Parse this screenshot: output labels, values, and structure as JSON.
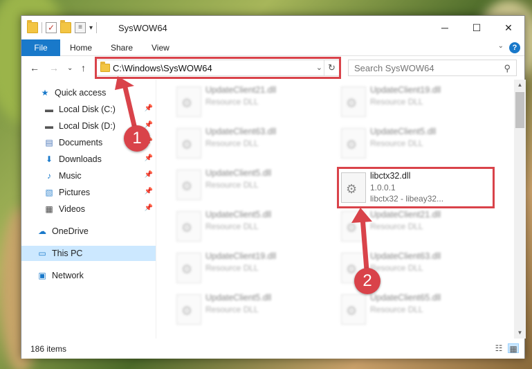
{
  "window": {
    "title": "SysWOW64",
    "controls": {
      "minimize": "─",
      "maximize": "☐",
      "close": "✕"
    }
  },
  "ribbon": {
    "file": "File",
    "tabs": [
      "Home",
      "Share",
      "View"
    ],
    "help": "?",
    "collapse": "⌄"
  },
  "nav": {
    "back": "←",
    "forward": "→",
    "recent": "⌄",
    "up": "↑",
    "address": "C:\\Windows\\SysWOW64",
    "address_dropdown": "⌄",
    "refresh": "↻",
    "search_placeholder": "Search SysWOW64",
    "search_icon_glyph": "⚲"
  },
  "sidebar": {
    "items": [
      {
        "label": "Quick access",
        "icon": "star-icon",
        "glyph": "★",
        "color": "#1979ca",
        "pinned": false
      },
      {
        "label": "Local Disk (C:)",
        "icon": "drive-icon",
        "glyph": "▬",
        "color": "#555555",
        "pinned": true
      },
      {
        "label": "Local Disk (D:)",
        "icon": "drive-icon",
        "glyph": "▬",
        "color": "#555555",
        "pinned": true
      },
      {
        "label": "Documents",
        "icon": "documents-icon",
        "glyph": "▤",
        "color": "#4a76b8",
        "pinned": true
      },
      {
        "label": "Downloads",
        "icon": "downloads-icon",
        "glyph": "⬇",
        "color": "#1979ca",
        "pinned": true
      },
      {
        "label": "Music",
        "icon": "music-icon",
        "glyph": "♪",
        "color": "#1979ca",
        "pinned": true
      },
      {
        "label": "Pictures",
        "icon": "pictures-icon",
        "glyph": "▧",
        "color": "#3c8bd1",
        "pinned": true
      },
      {
        "label": "Videos",
        "icon": "videos-icon",
        "glyph": "▦",
        "color": "#444444",
        "pinned": true
      },
      {
        "label": "OneDrive",
        "icon": "onedrive-icon",
        "glyph": "☁",
        "color": "#1979ca",
        "pinned": false
      },
      {
        "label": "This PC",
        "icon": "this-pc-icon",
        "glyph": "▭",
        "color": "#1979ca",
        "pinned": false,
        "selected": true
      },
      {
        "label": "Network",
        "icon": "network-icon",
        "glyph": "▣",
        "color": "#1979ca",
        "pinned": false
      }
    ],
    "pin_glyph": "📌"
  },
  "files": {
    "left_column": [
      {
        "name": "UpdateClient21.dll",
        "type": "Resource DLL"
      },
      {
        "name": "UpdateClient63.dll",
        "type": "Resource DLL"
      },
      {
        "name": "UpdateClient5.dll",
        "type": "Resource DLL"
      },
      {
        "name": "UpdateClient5.dll",
        "type": "Resource DLL"
      },
      {
        "name": "UpdateClient19.dll",
        "type": "Resource DLL"
      },
      {
        "name": "UpdateClient5.dll",
        "type": "Resource DLL"
      }
    ],
    "right_column": [
      {
        "name": "UpdateClient19.dll",
        "type": "Resource DLL"
      },
      {
        "name": "UpdateClient5.dll",
        "type": "Resource DLL"
      },
      {
        "name": "libctx32.dll",
        "version": "1.0.0.1",
        "description": "libctx32 - libeay32..."
      },
      {
        "name": "UpdateClient21.dll",
        "type": "Resource DLL"
      },
      {
        "name": "UpdateClient63.dll",
        "type": "Resource DLL"
      },
      {
        "name": "UpdateClient65.dll",
        "type": "Resource DLL"
      }
    ]
  },
  "status": {
    "item_count": "186 items"
  },
  "annotations": {
    "step1": "1",
    "step2": "2",
    "highlight_color": "#d9434a"
  }
}
